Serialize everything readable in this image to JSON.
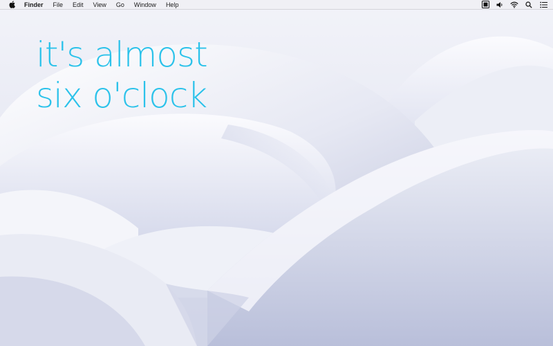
{
  "menubar": {
    "apple_icon": "apple-logo-icon",
    "app_name": "Finder",
    "items": [
      "File",
      "Edit",
      "View",
      "Go",
      "Window",
      "Help"
    ],
    "status_icons": [
      "screen-icon",
      "volume-icon",
      "wifi-icon",
      "search-icon",
      "list-icon"
    ]
  },
  "desktop": {
    "clock_line1": "it's almost",
    "clock_line2": "six o'clock",
    "text_color": "#2bc2ea"
  }
}
